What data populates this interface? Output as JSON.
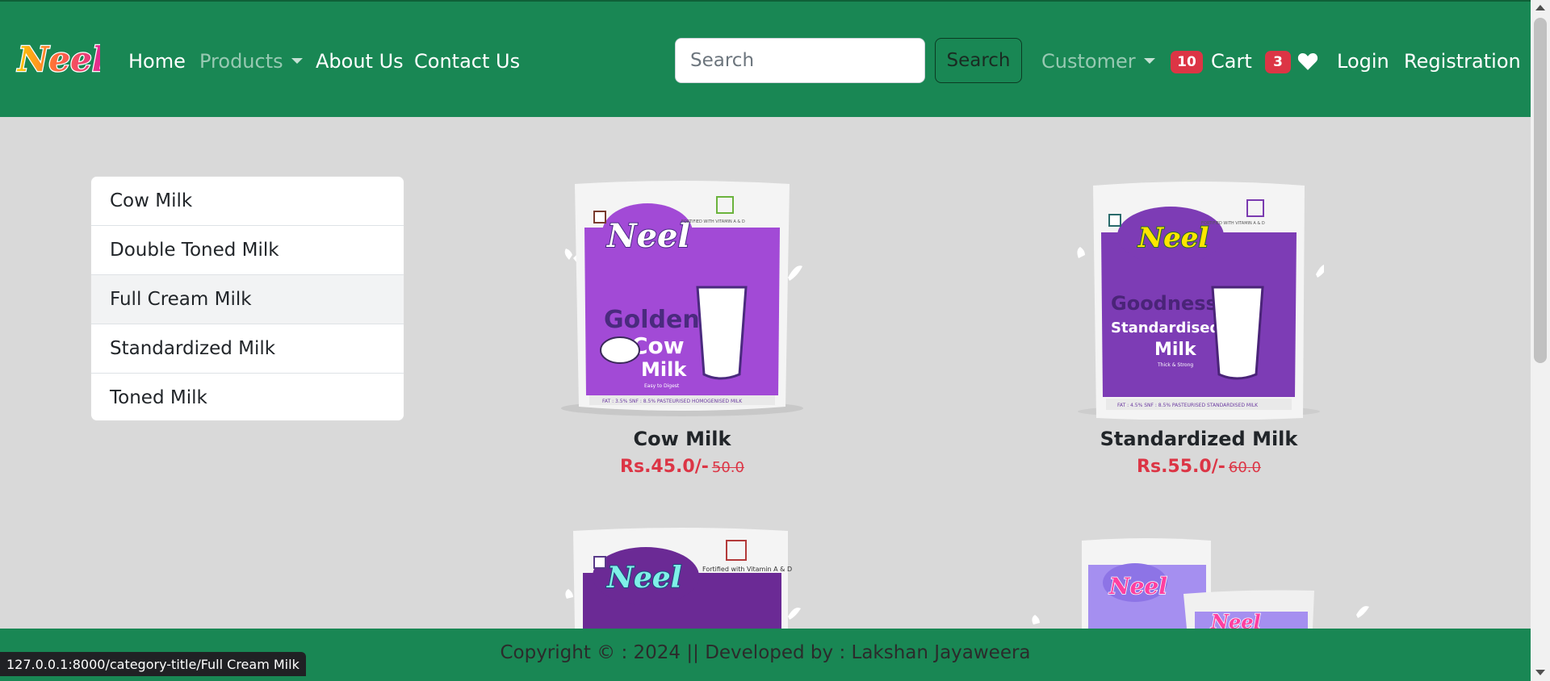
{
  "brand": {
    "logo_text": "Neel"
  },
  "nav": {
    "home": "Home",
    "products": "Products",
    "about": "About Us",
    "contact": "Contact Us",
    "customer": "Customer",
    "cart_label": "Cart",
    "cart_count": "10",
    "wishlist_count": "3",
    "login": "Login",
    "registration": "Registration"
  },
  "search": {
    "placeholder": "Search",
    "button_label": "Search",
    "value": ""
  },
  "categories": [
    "Cow Milk",
    "Double Toned Milk",
    "Full Cream Milk",
    "Standardized Milk",
    "Toned Milk"
  ],
  "products": [
    {
      "name": "Cow Milk",
      "price": "Rs.45.0/-",
      "old_price": "50.0",
      "pack_lines": [
        "Golden",
        "Cow",
        "Milk"
      ],
      "pack_subtext": "Easy to Digest",
      "pack_color": "#a24ad6",
      "pack_header": "FORTIFIED WITH VITAMIN A & D",
      "pack_footer": "FAT : 3.5%  SNF : 8.5%  PASTEURISED HOMOGENISED MILK"
    },
    {
      "name": "Standardized Milk",
      "price": "Rs.55.0/-",
      "old_price": "60.0",
      "pack_lines": [
        "Goodness",
        "Standardised",
        "Milk"
      ],
      "pack_subtext": "Thick & Strong",
      "pack_color": "#7d3cb5",
      "pack_header": "FORTIFIED WITH VITAMIN A & D",
      "pack_footer": "FAT : 4.5%  SNF : 8.5%  PASTEURISED STANDARDISED MILK"
    },
    {
      "pack_color": "#6b2a95",
      "pack_header": "Fortified with Vitamin A & D"
    },
    {
      "pack_color": "#a58ff0"
    }
  ],
  "footer": {
    "text": "Copyright © : 2024 || Developed by : Lakshan Jayaweera"
  },
  "status_url": "127.0.0.1:8000/category-title/Full Cream Milk",
  "colors": {
    "primary": "#198754",
    "danger": "#dc3545",
    "background": "#d9d9d9"
  }
}
